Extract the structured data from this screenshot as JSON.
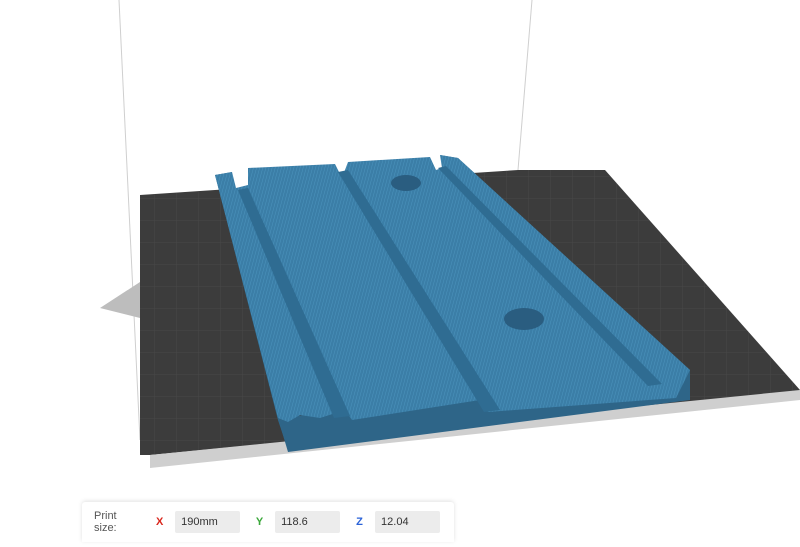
{
  "print_size": {
    "label": "Print size:",
    "x_label": "X",
    "x_value": "190mm",
    "y_label": "Y",
    "y_value": "118.6",
    "z_label": "Z",
    "z_value": "12.04"
  },
  "colors": {
    "model": "#3a7ca5",
    "plate": "#3d3d3d",
    "plate_edge": "#c8c8c8",
    "axis_x": "#d9261c",
    "axis_y": "#3aa83a",
    "axis_z": "#2a62d8"
  }
}
